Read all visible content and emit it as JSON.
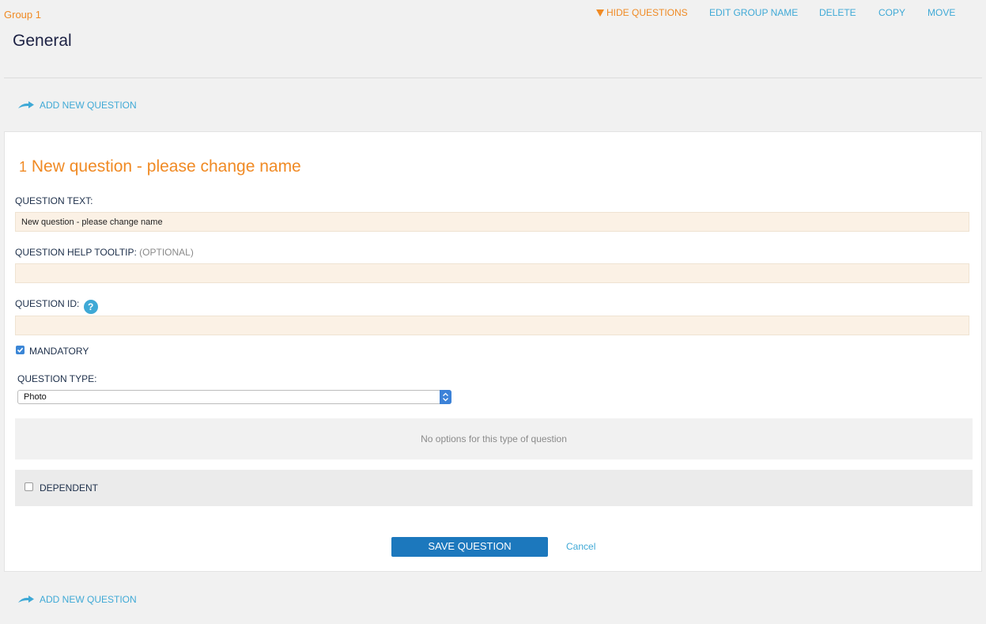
{
  "group": {
    "label": "Group 1",
    "title": "General"
  },
  "toolbar": {
    "hide_questions": "HIDE QUESTIONS",
    "edit_group_name": "EDIT GROUP NAME",
    "delete": "DELETE",
    "copy": "COPY",
    "move": "MOVE"
  },
  "add_question": {
    "label": "ADD NEW QUESTION"
  },
  "question": {
    "number": "1",
    "title": "New question - please change name",
    "text_label": "QUESTION TEXT:",
    "text_value": "New question - please change name",
    "tooltip_label": "QUESTION HELP TOOLTIP:",
    "tooltip_optional": "(OPTIONAL)",
    "tooltip_value": "",
    "id_label": "QUESTION ID:",
    "id_help": "?",
    "id_value": "",
    "mandatory_label": "MANDATORY",
    "mandatory_checked": true,
    "type_label": "QUESTION TYPE:",
    "type_value": "Photo",
    "no_options_message": "No options for this type of question",
    "dependent_label": "DEPENDENT",
    "dependent_checked": false,
    "save_label": "SAVE QUESTION",
    "cancel_label": "Cancel"
  },
  "colors": {
    "accent_orange": "#f08a24",
    "link_blue": "#3fa9d6",
    "primary_button": "#1c78bd",
    "input_bg": "#fbf1e5"
  }
}
